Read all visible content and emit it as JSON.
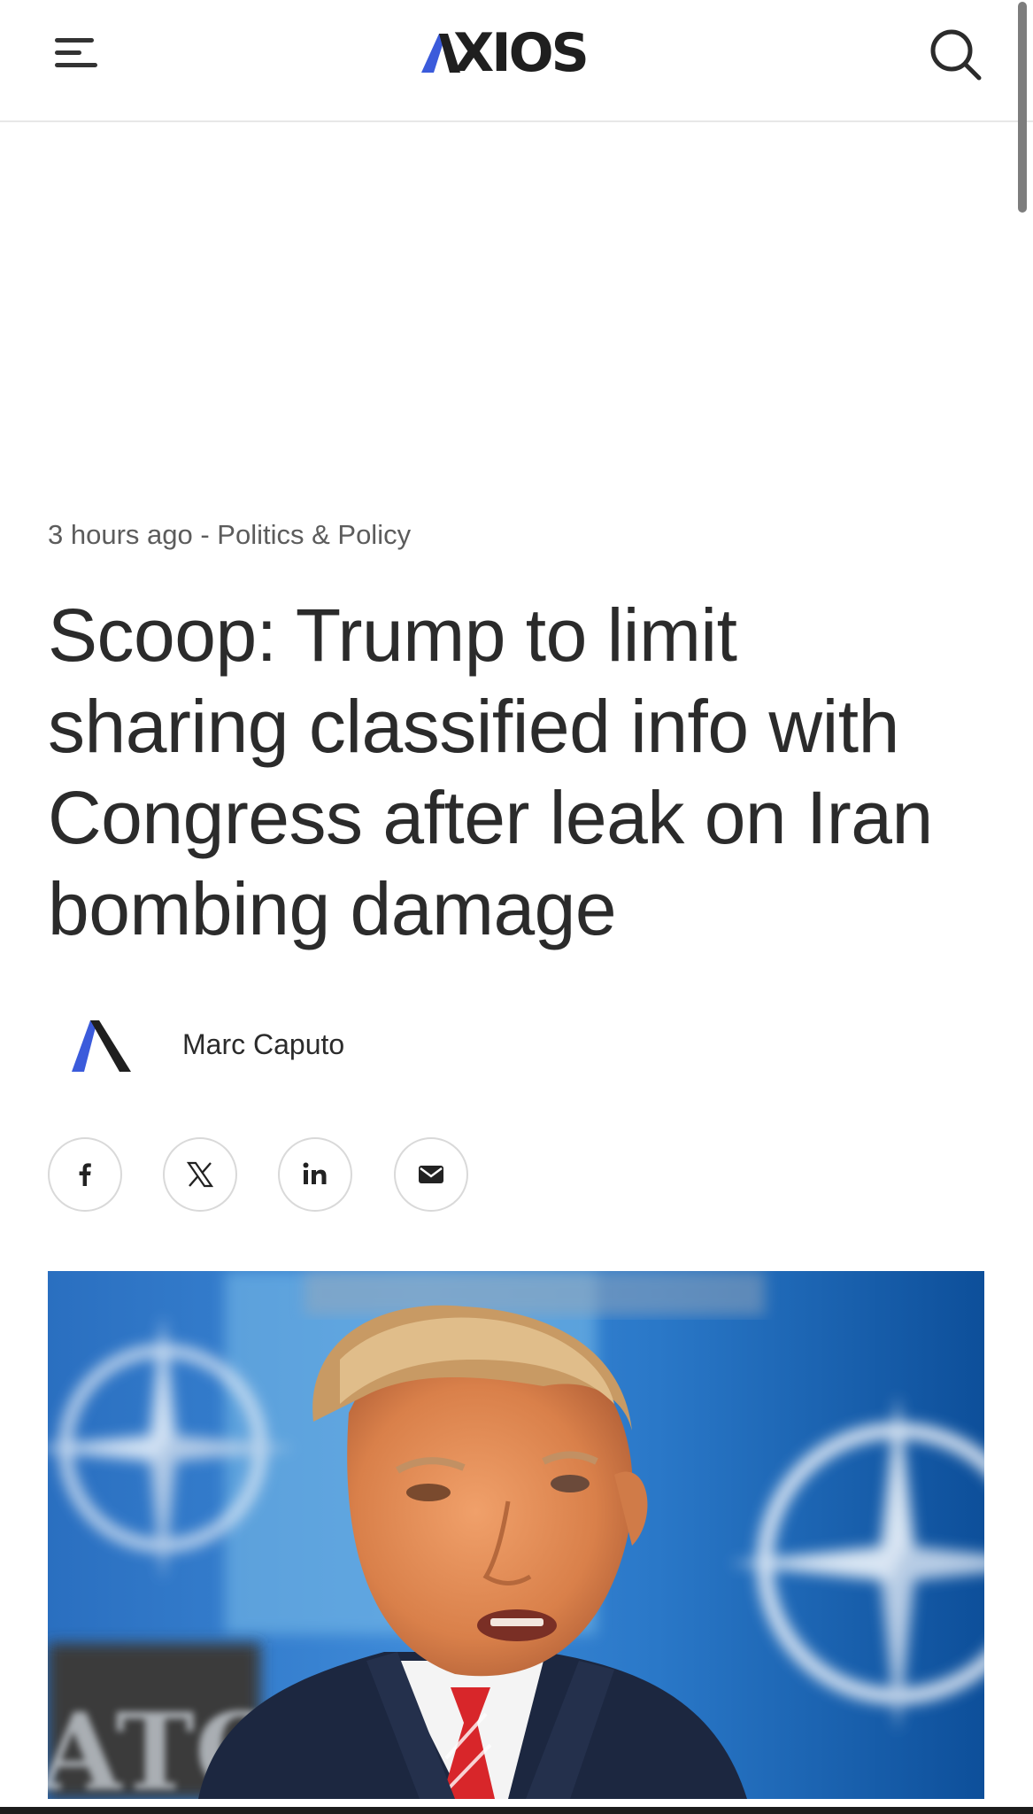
{
  "header": {
    "logo_text": "XIOS",
    "logo_accent_color": "#3b5bdb",
    "menu_icon": "hamburger-menu-icon",
    "search_icon": "search-icon"
  },
  "article": {
    "time_ago": "3 hours ago",
    "separator": " - ",
    "category": "Politics & Policy",
    "headline": "Scoop: Trump to limit sharing classified info with Congress after leak on Iran bombing damage",
    "author": {
      "name": "Marc Caputo",
      "avatar_icon": "axios-a-logo-icon"
    },
    "share_buttons": [
      {
        "icon": "facebook-icon"
      },
      {
        "icon": "x-twitter-icon"
      },
      {
        "icon": "linkedin-icon"
      },
      {
        "icon": "email-icon"
      }
    ],
    "hero_image": {
      "image_text": "ATO"
    }
  },
  "colors": {
    "text_primary": "#2b2b2b",
    "text_meta": "#5c5c5c",
    "brand_blue": "#3b5bdb",
    "nato_blue": "#2a6fc0"
  }
}
